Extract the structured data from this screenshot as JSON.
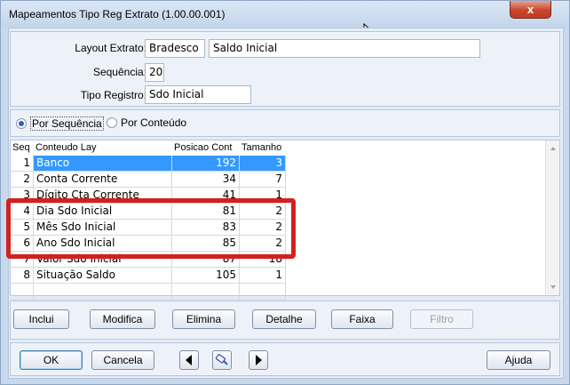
{
  "window": {
    "title": "Mapeamentos Tipo Reg Extrato (1.00.00.001)",
    "close_glyph": "x"
  },
  "form": {
    "layout_label": "Layout Extrato:",
    "layout_code": "Bradesco",
    "layout_desc": "Saldo Inicial",
    "sequence_label": "Sequência:",
    "sequence_value": "20",
    "tipo_label": "Tipo Registro:",
    "tipo_value": "Sdo Inicial"
  },
  "order": {
    "by_sequence": "Por Sequência",
    "by_content": "Por Conteúdo",
    "selected": "by_sequence"
  },
  "grid": {
    "columns": [
      "Seq",
      "Conteudo Lay",
      "Posicao Cont",
      "Tamanho"
    ],
    "rows": [
      {
        "seq": "1",
        "conteudo": "Banco",
        "posicao": "192",
        "tamanho": "3",
        "selected": true
      },
      {
        "seq": "2",
        "conteudo": "Conta Corrente",
        "posicao": "34",
        "tamanho": "7"
      },
      {
        "seq": "3",
        "conteudo": "Dígito Cta Corrente",
        "posicao": "41",
        "tamanho": "1"
      },
      {
        "seq": "4",
        "conteudo": "Dia Sdo Inicial",
        "posicao": "81",
        "tamanho": "2"
      },
      {
        "seq": "5",
        "conteudo": "Mês Sdo Inicial",
        "posicao": "83",
        "tamanho": "2"
      },
      {
        "seq": "6",
        "conteudo": "Ano Sdo Inicial",
        "posicao": "85",
        "tamanho": "2"
      },
      {
        "seq": "7",
        "conteudo": "Valor Sdo Inicial",
        "posicao": "87",
        "tamanho": "18"
      },
      {
        "seq": "8",
        "conteudo": "Situação Saldo",
        "posicao": "105",
        "tamanho": "1"
      }
    ]
  },
  "actions": {
    "inclui": "Inclui",
    "modifica": "Modifica",
    "elimina": "Elimina",
    "detalhe": "Detalhe",
    "faixa": "Faixa",
    "filtro": "Filtro"
  },
  "footer": {
    "ok": "OK",
    "cancela": "Cancela",
    "ajuda": "Ajuda",
    "prev_icon": "triangle-left-icon",
    "search_icon": "flashlight-icon",
    "next_icon": "triangle-right-icon"
  },
  "colors": {
    "selection": "#3399ff",
    "highlight_box": "#d41f1f",
    "window_bg": "#e4ecf6"
  }
}
